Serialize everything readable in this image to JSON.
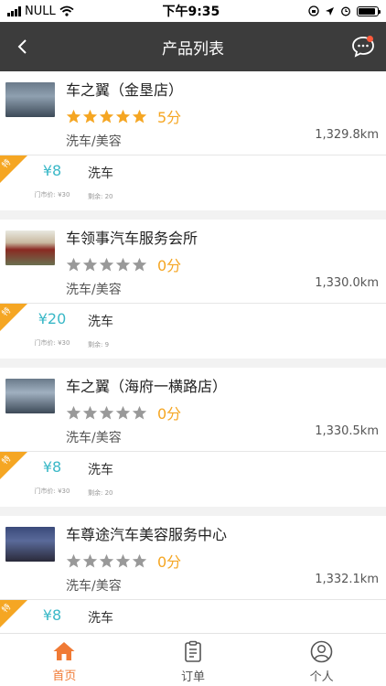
{
  "status": {
    "carrier": "NULL",
    "time": "下午9:35"
  },
  "nav": {
    "title": "产品列表"
  },
  "labels": {
    "orig_prefix": "门市价:",
    "remain_prefix": "剩余:",
    "tag": "特"
  },
  "shops": [
    {
      "name": "车之翼（金垦店）",
      "score": "5分",
      "stars_filled": 5,
      "category": "洗车/美容",
      "distance": "1,329.8km",
      "product": {
        "price": "¥8",
        "orig_price": "门市价: ¥30",
        "name": "洗车",
        "remaining": "剩余: 20"
      }
    },
    {
      "name": "车领事汽车服务会所",
      "score": "0分",
      "stars_filled": 0,
      "category": "洗车/美容",
      "distance": "1,330.0km",
      "product": {
        "price": "¥20",
        "orig_price": "门市价: ¥30",
        "name": "洗车",
        "remaining": "剩余: 9"
      }
    },
    {
      "name": "车之翼（海府一横路店）",
      "score": "0分",
      "stars_filled": 0,
      "category": "洗车/美容",
      "distance": "1,330.5km",
      "product": {
        "price": "¥8",
        "orig_price": "门市价: ¥30",
        "name": "洗车",
        "remaining": "剩余: 20"
      }
    },
    {
      "name": "车尊途汽车美容服务中心",
      "score": "0分",
      "stars_filled": 0,
      "category": "洗车/美容",
      "distance": "1,332.1km",
      "product": {
        "price": "¥8",
        "orig_price": "",
        "name": "洗车",
        "remaining": ""
      }
    }
  ],
  "tabs": [
    {
      "label": "首页",
      "icon": "home-icon",
      "active": true
    },
    {
      "label": "订单",
      "icon": "order-icon",
      "active": false
    },
    {
      "label": "个人",
      "icon": "person-icon",
      "active": false
    }
  ],
  "colors": {
    "accent": "#f07a35",
    "star_on": "#f5a623",
    "star_off": "#999999",
    "price": "#3ab8c7",
    "nav_bg": "#3c3c3c"
  }
}
